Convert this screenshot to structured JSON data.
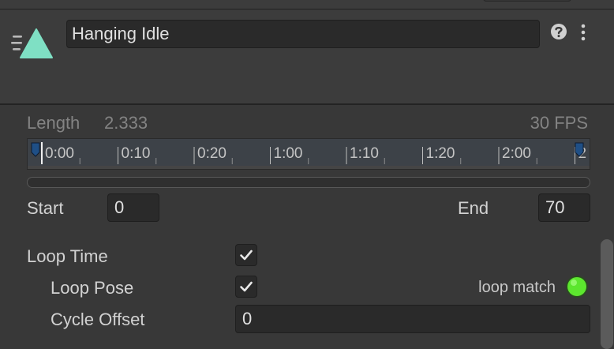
{
  "header": {
    "clip_name": "Hanging Idle",
    "icon": "animation-clip-icon",
    "help_icon": "help-icon",
    "more_icon": "more-options-icon",
    "accent_color": "#7fe0c4"
  },
  "clip_info": {
    "length_label": "Length",
    "length_value": "2.333",
    "fps_label": "30 FPS"
  },
  "timeline": {
    "ticks": [
      "0:00",
      "0:10",
      "0:20",
      "1:00",
      "1:10",
      "1:20",
      "2:00",
      "2"
    ]
  },
  "range": {
    "start_label": "Start",
    "start_value": "0",
    "end_label": "End",
    "end_value": "70"
  },
  "loop": {
    "loop_time_label": "Loop Time",
    "loop_time_checked": true,
    "loop_pose_label": "Loop Pose",
    "loop_pose_checked": true,
    "loop_match_label": "loop match",
    "loop_match_color": "#5ce62e",
    "cycle_offset_label": "Cycle Offset",
    "cycle_offset_value": "0"
  }
}
